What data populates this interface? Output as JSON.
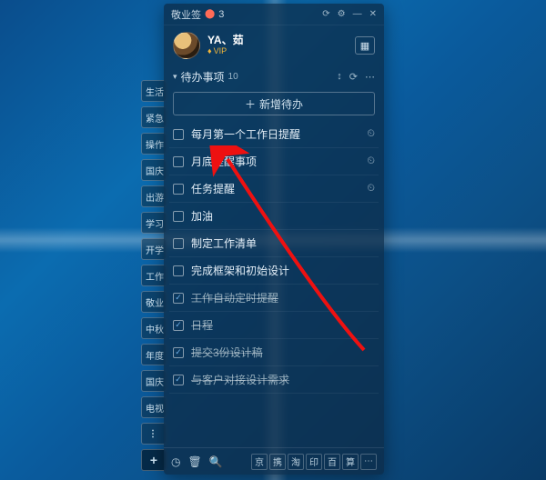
{
  "titlebar": {
    "app_name": "敬业签",
    "badge": "3"
  },
  "user": {
    "name": "YA、茹",
    "vip": "VIP"
  },
  "section": {
    "title": "待办事项",
    "count": "10",
    "add_label": "新增待办"
  },
  "todos": [
    {
      "text": "每月第一个工作日提醒",
      "done": false,
      "has_clock": true
    },
    {
      "text": "月底提醒事项",
      "done": false,
      "has_clock": true
    },
    {
      "text": "任务提醒",
      "done": false,
      "has_clock": true
    },
    {
      "text": "加油",
      "done": false,
      "has_clock": false
    },
    {
      "text": "制定工作清单",
      "done": false,
      "has_clock": false
    },
    {
      "text": "完成框架和初始设计",
      "done": false,
      "has_clock": false
    },
    {
      "text": "工作自动定时提醒",
      "done": true,
      "has_clock": false
    },
    {
      "text": "日程",
      "done": true,
      "has_clock": false
    },
    {
      "text": "提交3份设计稿",
      "done": true,
      "has_clock": false
    },
    {
      "text": "与客户对接设计需求",
      "done": true,
      "has_clock": false
    }
  ],
  "side_tabs": [
    "生活",
    "紧急",
    "操作",
    "国庆",
    "出游",
    "学习",
    "开学",
    "工作",
    "敬业",
    "中秋",
    "年度",
    "国庆",
    "电视"
  ],
  "footer_minis": [
    "京",
    "携",
    "淘",
    "印",
    "百",
    "算"
  ]
}
